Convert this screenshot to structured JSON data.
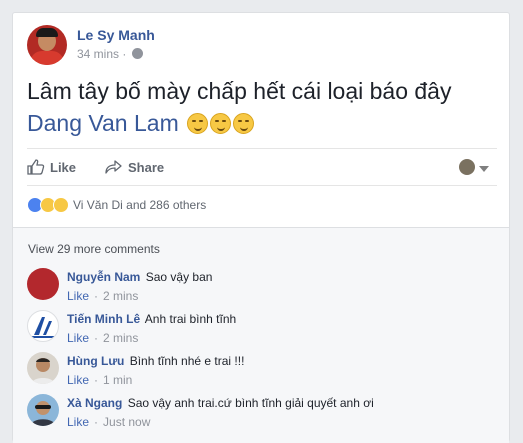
{
  "post": {
    "author": "Le Sy Manh",
    "time": "34 mins",
    "meta_separator": "·",
    "text_line1": "Lâm tây bố mày chấp hết cái loại báo đây",
    "tagged": "Dang Van Lam",
    "emoji_count": 3
  },
  "actions": {
    "like_label": "Like",
    "share_label": "Share"
  },
  "reactions": {
    "summary": "Vi Văn Di and 286 others"
  },
  "comments_section": {
    "view_more": "View 29 more comments",
    "like_label": "Like",
    "separator": "·",
    "items": [
      {
        "name": "Nguyễn Nam",
        "text": "Sao vậy ban",
        "time": "2 mins",
        "avatar_color": "#b3282d"
      },
      {
        "name": "Tiến Minh Lê",
        "text": "Anh trai bình tĩnh",
        "time": "2 mins",
        "avatar_color": "#ffffff"
      },
      {
        "name": "Hùng Lưu",
        "text": "Bình tĩnh nhé e trai !!!",
        "time": "1 min",
        "avatar_color": "#d9d4cc"
      },
      {
        "name": "Xà Ngang",
        "text": "Sao vậy anh trai.cứ bình tĩnh giải quyết anh ơi",
        "time": "Just now",
        "avatar_color": "#8bb6d9"
      }
    ]
  },
  "colors": {
    "link": "#385898",
    "like_blue": "#4267b2",
    "muted": "#90949c"
  }
}
